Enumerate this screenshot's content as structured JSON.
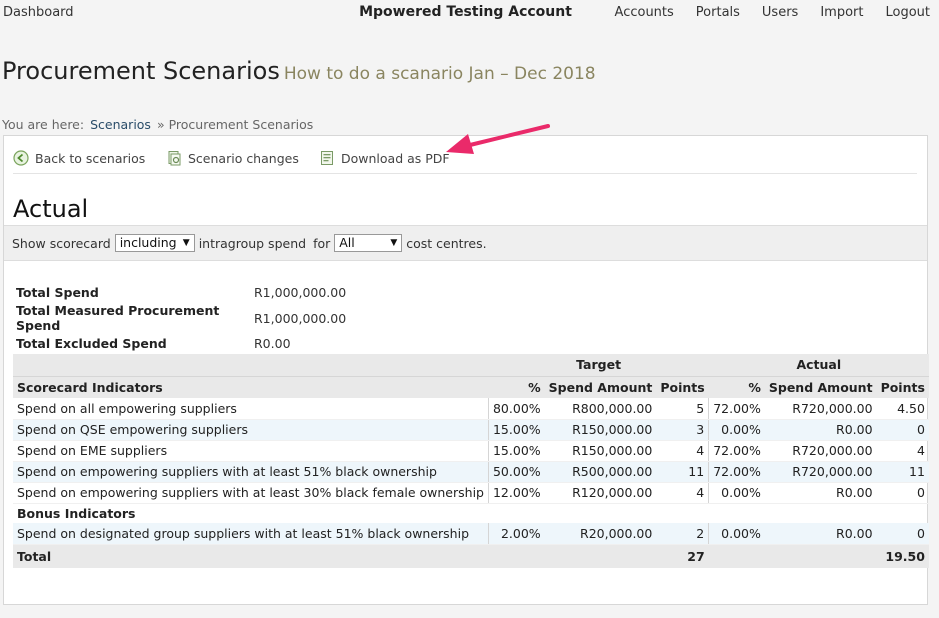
{
  "topnav": {
    "dashboard": "Dashboard",
    "account": "Mpowered Testing Account",
    "links": [
      "Accounts",
      "Portals",
      "Users",
      "Import",
      "Logout"
    ]
  },
  "page": {
    "title": "Procurement Scenarios",
    "subtitle": "How to do a scanario Jan – Dec 2018"
  },
  "breadcrumb": {
    "prefix": "You are here:",
    "link": "Scenarios",
    "current": "» Procurement Scenarios"
  },
  "actions": {
    "back": "Back to scenarios",
    "changes": "Scenario changes",
    "pdf": "Download as PDF"
  },
  "section": {
    "title": "Actual"
  },
  "filter": {
    "show_label": "Show scorecard",
    "intragroup_value": "including",
    "intragroup_label": "intragroup spend",
    "for_label": "for",
    "cost_value": "All",
    "cost_label": "cost centres."
  },
  "totals": [
    {
      "label": "Total Spend",
      "value": "R1,000,000.00"
    },
    {
      "label": "Total Measured Procurement Spend",
      "value": "R1,000,000.00"
    },
    {
      "label": "Total Excluded Spend",
      "value": "R0.00"
    }
  ],
  "table": {
    "group_target": "Target",
    "group_actual": "Actual",
    "headers": [
      "Scorecard Indicators",
      "%",
      "Spend Amount",
      "Points",
      "%",
      "Spend Amount",
      "Points"
    ],
    "rows": [
      {
        "name": "Spend on all empowering suppliers",
        "t_pct": "80.00%",
        "t_amt": "R800,000.00",
        "t_pts": "5",
        "a_pct": "72.00%",
        "a_amt": "R720,000.00",
        "a_pts": "4.50"
      },
      {
        "name": "Spend on QSE empowering suppliers",
        "t_pct": "15.00%",
        "t_amt": "R150,000.00",
        "t_pts": "3",
        "a_pct": "0.00%",
        "a_amt": "R0.00",
        "a_pts": "0"
      },
      {
        "name": "Spend on EME suppliers",
        "t_pct": "15.00%",
        "t_amt": "R150,000.00",
        "t_pts": "4",
        "a_pct": "72.00%",
        "a_amt": "R720,000.00",
        "a_pts": "4"
      },
      {
        "name": "Spend on empowering suppliers with at least 51% black ownership",
        "t_pct": "50.00%",
        "t_amt": "R500,000.00",
        "t_pts": "11",
        "a_pct": "72.00%",
        "a_amt": "R720,000.00",
        "a_pts": "11"
      },
      {
        "name": "Spend on empowering suppliers with at least 30% black female ownership",
        "t_pct": "12.00%",
        "t_amt": "R120,000.00",
        "t_pts": "4",
        "a_pct": "0.00%",
        "a_amt": "R0.00",
        "a_pts": "0"
      }
    ],
    "bonus_label": "Bonus Indicators",
    "bonus_rows": [
      {
        "name": "Spend on designated group suppliers with at least 51% black ownership",
        "t_pct": "2.00%",
        "t_amt": "R20,000.00",
        "t_pts": "2",
        "a_pct": "0.00%",
        "a_amt": "R0.00",
        "a_pts": "0"
      }
    ],
    "total_label": "Total",
    "total_target_points": "27",
    "total_actual_points": "19.50"
  }
}
